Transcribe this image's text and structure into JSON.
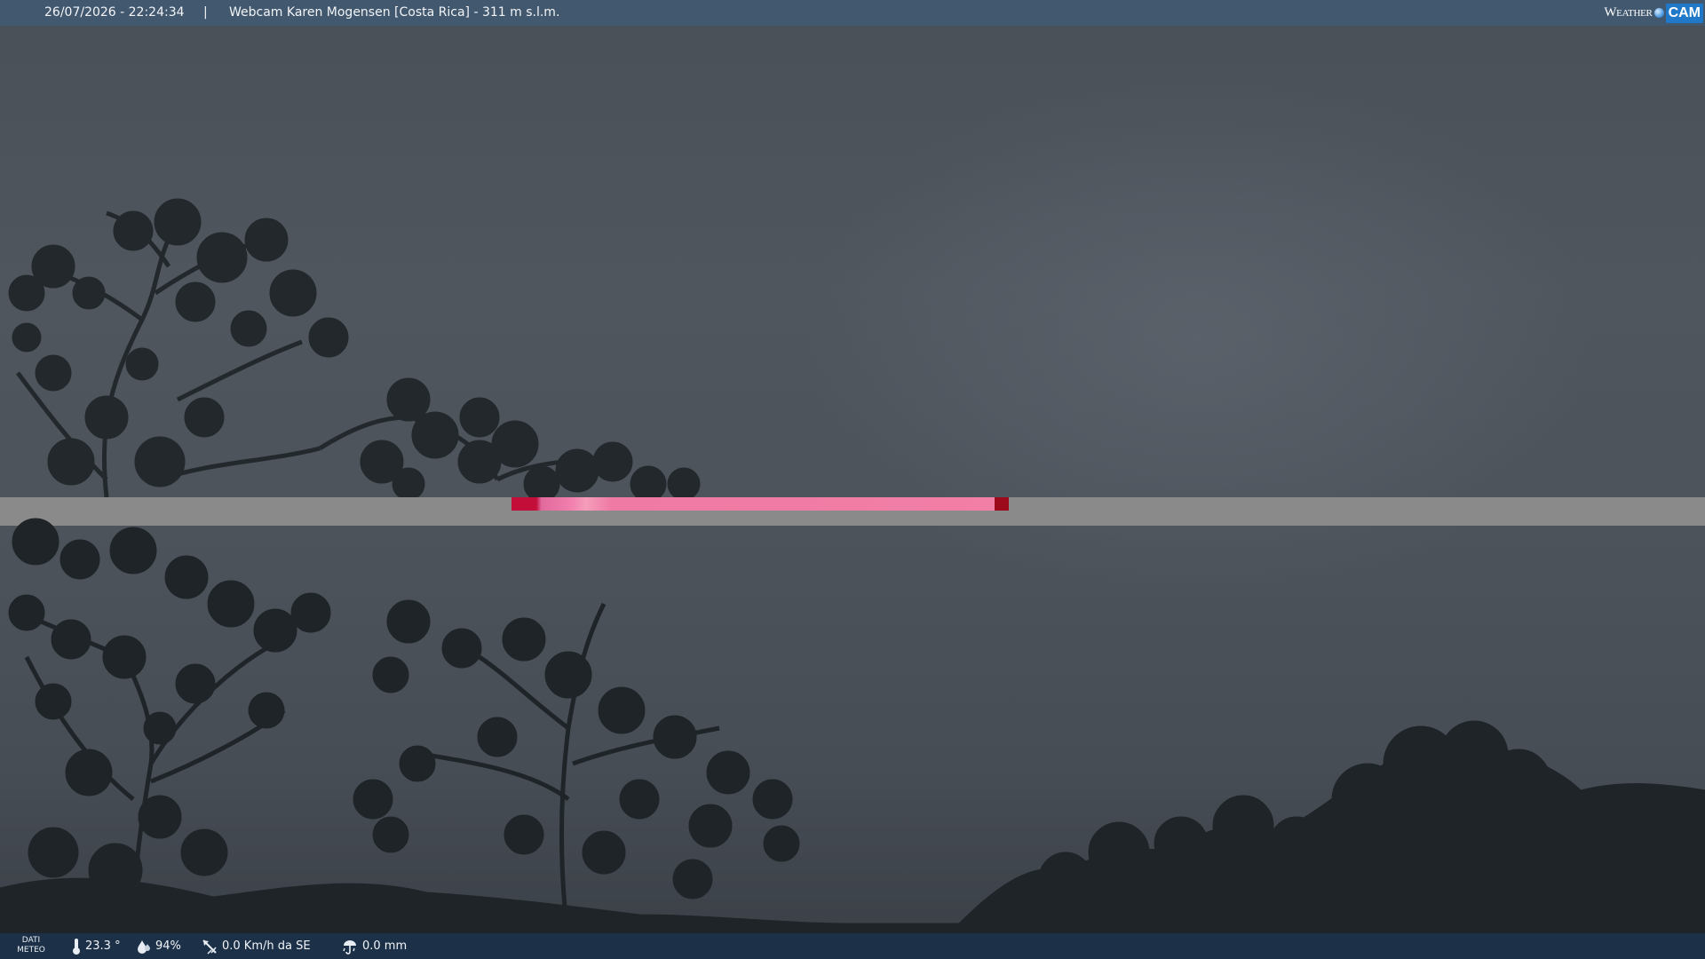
{
  "top_bar": {
    "date_time": "26/07/2026 - 22:24:34",
    "separator": "|",
    "title": "Webcam Karen Mogensen [Costa Rica]  - 311 m s.l.m.",
    "brand_weather": "Weather",
    "brand_cam": "CAM"
  },
  "bottom_bar": {
    "dati": "DATI",
    "meteo": "METEO",
    "temperature": "23.3 °",
    "humidity": "94%",
    "wind": "0.0 Km/h da SE",
    "rain": "0.0 mm"
  },
  "icons": {
    "temperature": "thermometer-icon",
    "humidity": "water-drop-icon",
    "wind": "wind-vane-icon",
    "rain": "rain-gauge-icon",
    "brand": "weathercam-logo-icon"
  },
  "colors": {
    "top_bar": "#42586f",
    "bottom_bar": "#1c344e",
    "glitch_band": "#8a8a8a",
    "glitch_strip": "#f27fa6",
    "glitch_red": "#c40e3a"
  }
}
